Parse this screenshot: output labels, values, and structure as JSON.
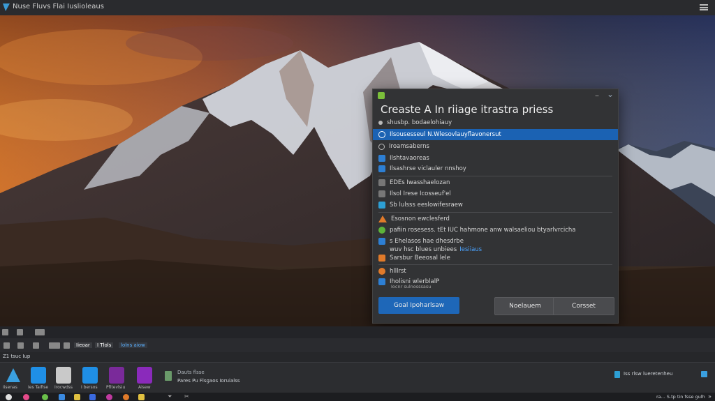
{
  "window": {
    "title": "Nuse Fluvs Flai Iuslioleaus"
  },
  "dialog": {
    "title": "Creaste A In riiage itrastra priess",
    "rows": [
      {
        "label": "shusbp. bodaelohiauy",
        "icon": "dot-icon",
        "color": "#bbbbbb"
      },
      {
        "label": "Ilsousesseul N.Wlesovlauyflavonersut",
        "icon": "globe-icon",
        "color": "#ffffff",
        "selected": true
      },
      {
        "label": "Iroamsaberns",
        "icon": "dot-icon",
        "color": "#bbbbbb"
      },
      {
        "label": "Ilshtavaoreas",
        "icon": "app-icon",
        "color": "#2d7fd4"
      },
      {
        "label": "Ilsashrse viclauler nnshoy",
        "icon": "app-icon",
        "color": "#2d7fd4"
      },
      {
        "label": "EDEs Iwasshaelozan",
        "icon": "image-icon",
        "color": "#777777"
      },
      {
        "label": "Ilsol Irese Icosseuf'el",
        "icon": "image-icon",
        "color": "#777777"
      },
      {
        "label": "Sb lulsss eeslowifesraew",
        "icon": "photo-icon",
        "color": "#2d9fd4"
      },
      {
        "label": "Esosnon ewclesferd",
        "icon": "warning-icon",
        "color": "#e07a2a"
      },
      {
        "label": "pafiin rosesess. tEt IUC hahmone anw walsaeliou btyarlvrcicha",
        "icon": "check-icon",
        "color": "#5db33a"
      },
      {
        "label": "s Ehelasos hae dhesdrbe",
        "icon": "shield-icon",
        "color": "#2d7fd4"
      },
      {
        "label": "wuv hsc blues unbiees",
        "icon": "link-icon",
        "color": "#2d7fd4",
        "extra": "Iesiiaus"
      },
      {
        "label": "Sarsbur Beeosal lele",
        "icon": "brush-icon",
        "color": "#e07a2a"
      },
      {
        "label": "hlllrst",
        "icon": "power-icon",
        "color": "#e07a2a"
      },
      {
        "label": "Iholisni wlerblalP",
        "icon": "badge-icon",
        "color": "#2d7fd4",
        "sub": "Iocnr sulnosssasu"
      }
    ],
    "buttons": {
      "primary": "Goal Ipoharlsaw",
      "middle": "Noelauem",
      "cancel": "Corsset"
    }
  },
  "panel": {
    "tags": [
      "Iieoar",
      "I Tlols",
      "lolns aiow"
    ],
    "section_label": "Z1 tsuc Iup"
  },
  "dock": {
    "items": [
      {
        "label": "Iisenas",
        "color": "#3aa0e0"
      },
      {
        "label": "Ies Taifise",
        "color": "#1f8fe6"
      },
      {
        "label": "Irocwdss",
        "color": "#c9c9c9"
      },
      {
        "label": "I bersos",
        "color": "#1f8fe6"
      },
      {
        "label": "Pfitevlsiu",
        "color": "#7a2a9a"
      },
      {
        "label": "Aisew",
        "color": "#8a2abb"
      }
    ],
    "info_line1": "Dauts flsse",
    "info_line2": "Pares Pu Flsgaos Ioruialss",
    "tray_text": "Iss rlsw lueretenheu"
  },
  "taskbar": {
    "status": "ra... S.tp tin fsse gulh",
    "chevron": "»"
  },
  "colors": {
    "accent": "#1e67b8",
    "dialog_bg": "#323335",
    "titlebar_bg": "#2a2b2e"
  }
}
